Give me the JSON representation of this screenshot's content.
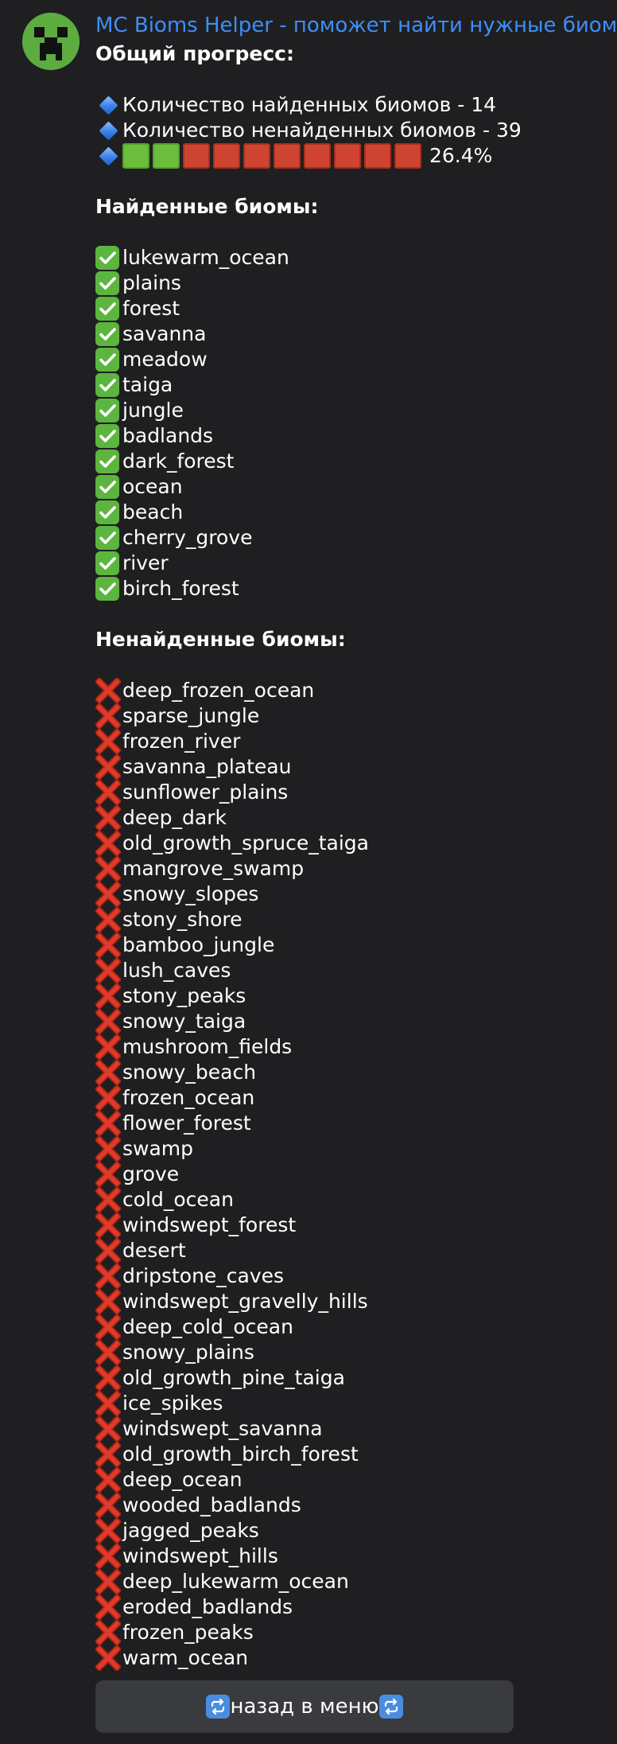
{
  "sender": "MC Bioms Helper - поможет найти нужные биомы!",
  "avatar_icon": "creeper-face-icon",
  "progress": {
    "heading": "Общий прогресс:",
    "found_line": "Количество найденных биомов - 14",
    "missing_line": "Количество ненайденных биомов - 39",
    "bar_green_cells": 2,
    "bar_total_cells": 10,
    "percent_text": "26.4%"
  },
  "found": {
    "heading": "Найденные биомы:",
    "icon": "check-mark-icon",
    "items": [
      "lukewarm_ocean",
      "plains",
      "forest",
      "savanna",
      "meadow",
      "taiga",
      "jungle",
      "badlands",
      "dark_forest",
      "ocean",
      "beach",
      "cherry_grove",
      "river",
      "birch_forest"
    ]
  },
  "missing": {
    "heading": "Ненайденные биомы:",
    "icon": "cross-mark-icon",
    "items": [
      "deep_frozen_ocean",
      "sparse_jungle",
      "frozen_river",
      "savanna_plateau",
      "sunflower_plains",
      "deep_dark",
      "old_growth_spruce_taiga",
      "mangrove_swamp",
      "snowy_slopes",
      "stony_shore",
      "bamboo_jungle",
      "lush_caves",
      "stony_peaks",
      "snowy_taiga",
      "mushroom_fields",
      "snowy_beach",
      "frozen_ocean",
      "flower_forest",
      "swamp",
      "grove",
      "cold_ocean",
      "windswept_forest",
      "desert",
      "dripstone_caves",
      "windswept_gravelly_hills",
      "deep_cold_ocean",
      "snowy_plains",
      "old_growth_pine_taiga",
      "ice_spikes",
      "windswept_savanna",
      "old_growth_birch_forest",
      "deep_ocean",
      "wooded_badlands",
      "jagged_peaks",
      "windswept_hills",
      "deep_lukewarm_ocean",
      "eroded_badlands",
      "frozen_peaks",
      "warm_ocean"
    ]
  },
  "back_button": {
    "label": "назад в меню",
    "icon": "repeat-arrows-icon"
  },
  "colors": {
    "background": "#1f1f21",
    "sender": "#3e8ef7",
    "cell_green": "#6cbd3b",
    "cell_red": "#cf4430",
    "button": "#3a3b3f"
  }
}
